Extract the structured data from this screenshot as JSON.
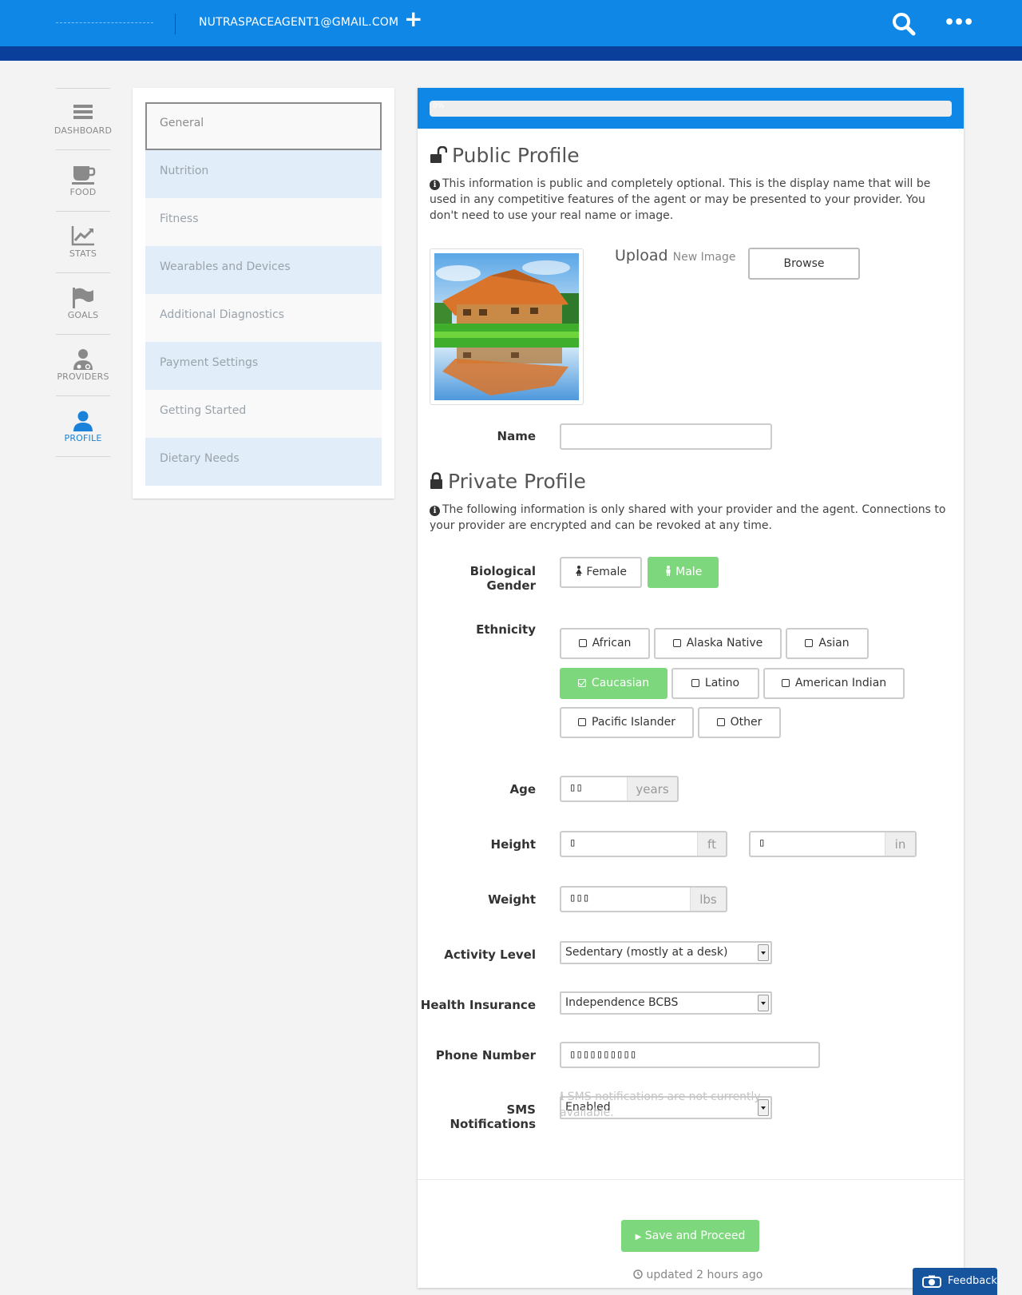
{
  "header": {
    "account_email": "NUTRASPACEAGENT1@GMAIL.COM",
    "add_icon": "plus-icon",
    "search_icon": "search-icon",
    "more_icon": "more-icon",
    "more_text": "•••"
  },
  "colors": {
    "primary": "#0f87e6",
    "header_strip": "#0b3f9c",
    "success": "#7dd87d",
    "active_nav": "#1a82d8",
    "menu_alt": "#e1eef9"
  },
  "leftnav": [
    {
      "label": "DASHBOARD",
      "icon": "dashboard-icon"
    },
    {
      "label": "FOOD",
      "icon": "food-icon"
    },
    {
      "label": "STATS",
      "icon": "stats-icon"
    },
    {
      "label": "GOALS",
      "icon": "goals-icon"
    },
    {
      "label": "PROVIDERS",
      "icon": "providers-icon"
    },
    {
      "label": "PROFILE",
      "icon": "profile-icon",
      "active": true
    }
  ],
  "menu": [
    {
      "label": "General",
      "selected": true
    },
    {
      "label": "Nutrition"
    },
    {
      "label": "Fitness"
    },
    {
      "label": "Wearables and Devices"
    },
    {
      "label": "Additional Diagnostics"
    },
    {
      "label": "Payment Settings"
    },
    {
      "label": "Getting Started"
    },
    {
      "label": "Dietary Needs"
    }
  ],
  "progress": {
    "label": "0%",
    "value": 0
  },
  "public": {
    "title": "Public Profile",
    "info": "This information is public and completely optional. This is the display name that will be used in any competitive features of the agent or may be presented to your provider. You don't need to use your real name or image.",
    "upload_label": "Upload",
    "upload_sub": "New Image",
    "browse_label": "Browse",
    "name_label": "Name",
    "name_value": ""
  },
  "private": {
    "title": "Private Profile",
    "info": "The following information is only shared with your provider and the agent. Connections to your provider are encrypted and can be revoked at any time.",
    "gender_label": "Biological Gender",
    "gender_options": [
      {
        "label": "Female",
        "selected": false
      },
      {
        "label": "Male",
        "selected": true
      }
    ],
    "ethnicity_label": "Ethnicity",
    "ethnicity_options": [
      {
        "label": "African",
        "selected": false
      },
      {
        "label": "Alaska Native",
        "selected": false
      },
      {
        "label": "Asian",
        "selected": false
      },
      {
        "label": "Caucasian",
        "selected": true
      },
      {
        "label": "Latino",
        "selected": false
      },
      {
        "label": "American Indian",
        "selected": false
      },
      {
        "label": "Pacific Islander",
        "selected": false
      },
      {
        "label": "Other",
        "selected": false
      }
    ],
    "age_label": "Age",
    "age_value": "▯▯",
    "age_unit": "years",
    "height_label": "Height",
    "height_ft_value": "▯",
    "height_ft_unit": "ft",
    "height_in_value": "▯",
    "height_in_unit": "in",
    "weight_label": "Weight",
    "weight_value": "▯▯▯",
    "weight_unit": "lbs",
    "activity_label": "Activity Level",
    "activity_value": "Sedentary (mostly at a desk)",
    "insurance_label": "Health Insurance",
    "insurance_value": "Independence BCBS",
    "phone_label": "Phone Number",
    "phone_value": "▯▯▯▯▯▯▯▯▯▯",
    "sms_label": "SMS Notifications",
    "sms_value": "Enabled",
    "sms_help": "SMS notifications are not currently available."
  },
  "footer": {
    "save_label": "Save and Proceed",
    "updated_text": "updated 2 hours ago"
  },
  "feedback": {
    "label": "Feedback"
  }
}
